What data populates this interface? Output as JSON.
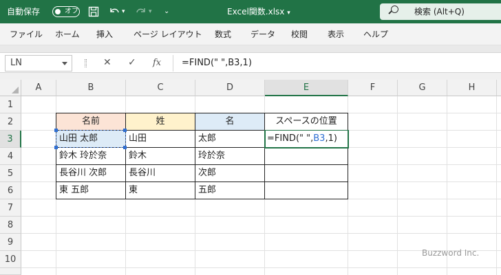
{
  "titlebar": {
    "autosave_label": "自動保存",
    "autosave_state": "オフ",
    "save_icon": "save-icon",
    "undo_icon": "undo-icon",
    "redo_icon": "redo-icon",
    "customize_icon": "customize-qat-icon",
    "document_title": "Excel関数.xlsx",
    "search_placeholder": "検索 (Alt+Q)",
    "brand_color": "#217346"
  },
  "menubar": {
    "items": [
      "ファイル",
      "ホーム",
      "挿入",
      "ページ レイアウト",
      "数式",
      "データ",
      "校閲",
      "表示",
      "ヘルプ"
    ]
  },
  "formulabar": {
    "name_box": "LN",
    "cancel_icon": "cancel-icon",
    "enter_icon": "enter-icon",
    "function_icon": "fx",
    "formula": "=FIND(\" \",B3,1)"
  },
  "grid": {
    "columns": [
      "A",
      "B",
      "C",
      "D",
      "E",
      "F",
      "G",
      "H"
    ],
    "rows": [
      "1",
      "2",
      "3",
      "4",
      "5",
      "6",
      "7",
      "8",
      "9",
      "10"
    ],
    "selected_column": "E",
    "selected_row": "3",
    "table": {
      "headers": [
        "名前",
        "姓",
        "名",
        "スペースの位置"
      ],
      "header_colors": [
        "#fce4d6",
        "#fff2cc",
        "#ddebf7",
        "#ffffff"
      ],
      "rows": [
        [
          "山田 太郎",
          "山田",
          "太郎",
          ""
        ],
        [
          "鈴木 玲於奈",
          "鈴木",
          "玲於奈",
          ""
        ],
        [
          "長谷川 次郎",
          "長谷川",
          "次郎",
          ""
        ],
        [
          "東 五郎",
          "東",
          "五郎",
          ""
        ]
      ],
      "editing_cell": {
        "prefix": "=FIND(\" \",",
        "ref": "B3",
        "suffix": ",1)"
      }
    }
  },
  "watermark": "Buzzword Inc."
}
